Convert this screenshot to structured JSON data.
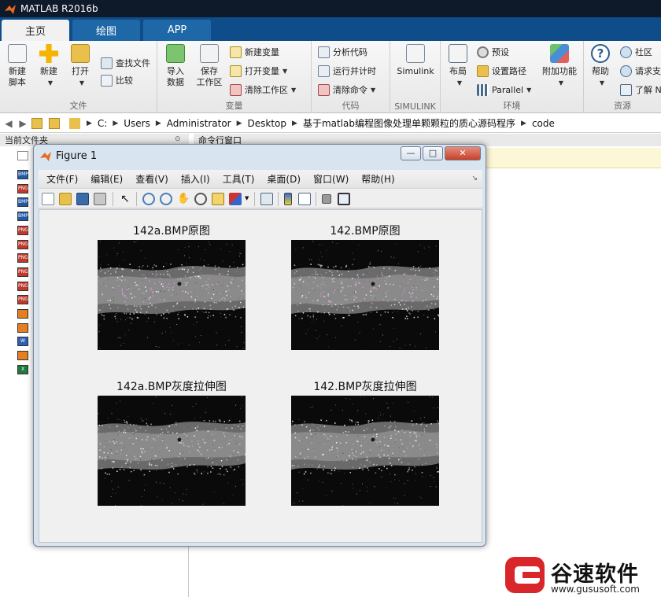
{
  "app": {
    "title": "MATLAB R2016b"
  },
  "tabs": [
    {
      "label": "主页"
    },
    {
      "label": "绘图"
    },
    {
      "label": "APP"
    }
  ],
  "ribbon": {
    "file": {
      "label": "文件",
      "new_script": "新建\n脚本",
      "new": "新建",
      "open": "打开",
      "find_files": "查找文件",
      "compare": "比较"
    },
    "variable": {
      "label": "变量",
      "import_data": "导入\n数据",
      "save_workspace": "保存\n工作区",
      "new_variable": "新建变量",
      "open_variable": "打开变量",
      "clear_workspace": "清除工作区"
    },
    "code": {
      "label": "代码",
      "analyze_code": "分析代码",
      "run_and_time": "运行并计时",
      "clear_commands": "清除命令"
    },
    "simulink": {
      "label": "SIMULINK",
      "simulink": "Simulink"
    },
    "environment": {
      "label": "环境",
      "layout": "布局",
      "preferences": "预设",
      "set_path": "设置路径",
      "parallel": "Parallel",
      "addons": "附加功能"
    },
    "resources": {
      "label": "资源",
      "help": "帮助",
      "community": "社区",
      "request_support": "请求支",
      "learn": "了解 N"
    }
  },
  "address": {
    "crumbs": [
      "C:",
      "Users",
      "Administrator",
      "Desktop",
      "基于matlab编程图像处理单颗颗粒的质心源码程序",
      "code"
    ]
  },
  "current_folder": {
    "header": "当前文件夹",
    "files": [
      {
        "type": "BMP",
        "color": "#1e5aa8"
      },
      {
        "type": "PNG",
        "color": "#c0392b"
      },
      {
        "type": "BMP",
        "color": "#1e5aa8"
      },
      {
        "type": "BMP",
        "color": "#1e5aa8"
      },
      {
        "type": "PNG",
        "color": "#c0392b"
      },
      {
        "type": "PNG",
        "color": "#c0392b"
      },
      {
        "type": "PNG",
        "color": "#c0392b"
      },
      {
        "type": "PNG",
        "color": "#c0392b"
      },
      {
        "type": "PNG",
        "color": "#c0392b"
      },
      {
        "type": "PNG",
        "color": "#c0392b"
      },
      {
        "type": "",
        "color": "#e67e22"
      },
      {
        "type": "",
        "color": "#e67e22"
      },
      {
        "type": "W",
        "color": "#2b5fb3"
      },
      {
        "type": "",
        "color": "#e67e22"
      },
      {
        "type": "X",
        "color": "#1e7a3c"
      }
    ]
  },
  "command_window": {
    "header": "命令行窗口"
  },
  "figure": {
    "title": "Figure 1",
    "menu": [
      "文件(F)",
      "编辑(E)",
      "查看(V)",
      "插入(I)",
      "工具(T)",
      "桌面(D)",
      "窗口(W)",
      "帮助(H)"
    ],
    "plots": [
      {
        "title": "142a.BMP原图"
      },
      {
        "title": "142.BMP原图"
      },
      {
        "title": "142a.BMP灰度拉伸图"
      },
      {
        "title": "142.BMP灰度拉伸图"
      }
    ]
  },
  "watermark": {
    "name": "谷速软件",
    "url": "www.gususoft.com"
  },
  "colors": {
    "tab_bar": "#0f4d8a",
    "title_bar": "#0e1a2a",
    "figure_frame": "#d8e4f0",
    "watermark_red": "#d9262a"
  }
}
